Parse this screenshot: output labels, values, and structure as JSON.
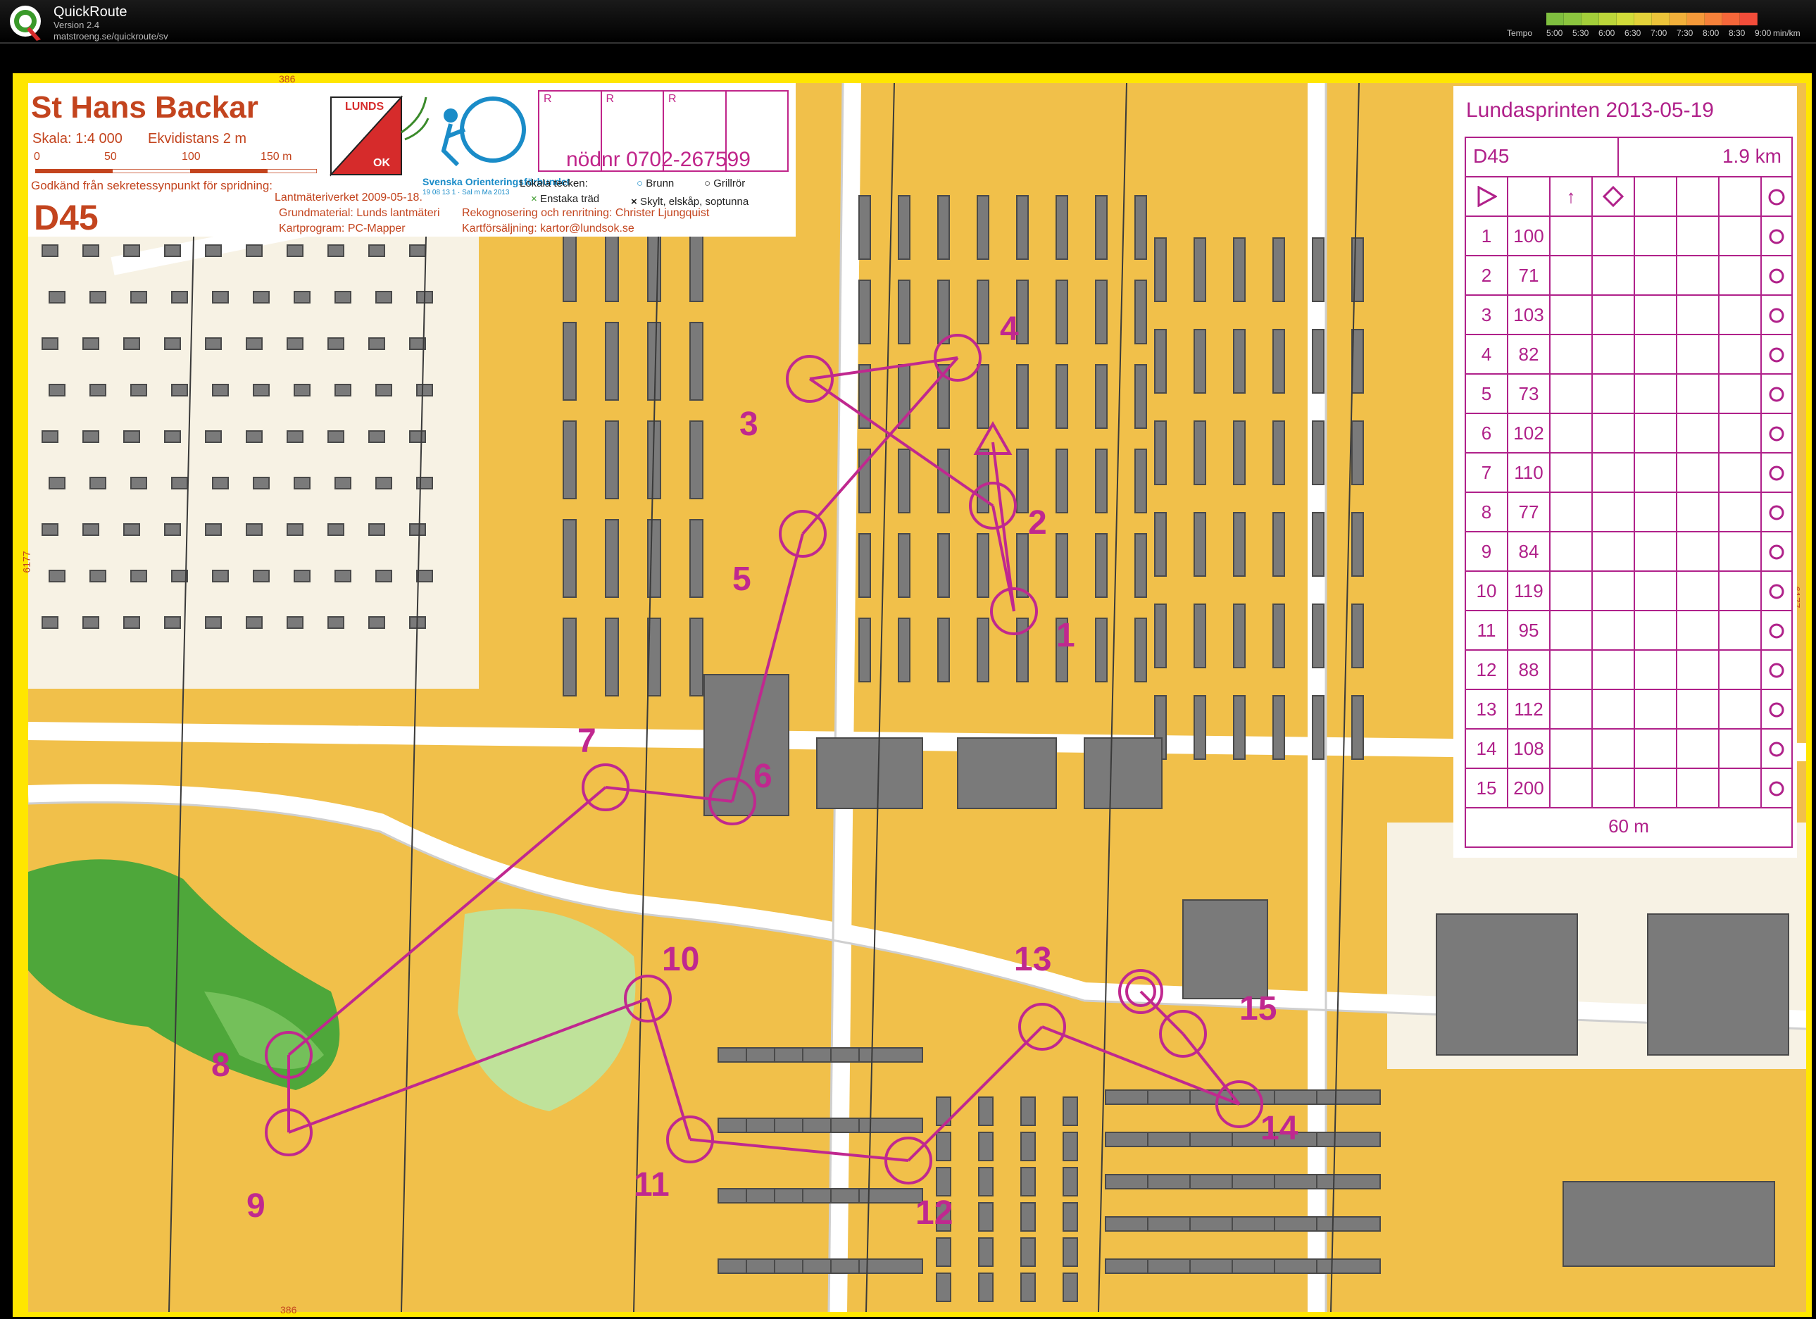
{
  "app": {
    "title": "QuickRoute",
    "version": "Version 2.4",
    "url": "matstroeng.se/quickroute/sv",
    "tempo_label": "Tempo",
    "tempo_ticks": [
      "5:00",
      "5:30",
      "6:00",
      "6:30",
      "7:00",
      "7:30",
      "8:00",
      "8:30",
      "9:00"
    ],
    "tempo_unit": "min/km",
    "tempo_colors": [
      "#7fbf3f",
      "#8cc63f",
      "#a3cf3a",
      "#bcd63a",
      "#d2dc3a",
      "#e3d23a",
      "#ecc43a",
      "#f2b03a",
      "#f59a3a",
      "#f6813a",
      "#f5673a",
      "#f34d3a"
    ]
  },
  "map_header": {
    "title": "St Hans Backar",
    "scale": "Skala: 1:4 000",
    "contour": "Ekvidistans 2 m",
    "scale_ticks": [
      "0",
      "50",
      "100",
      "150 m"
    ],
    "approval": "Godkänd från sekretessynpunkt för spridning:",
    "lantmateri": "Lantmäteriverket 2009-05-18.",
    "class": "D45",
    "base_material": "Grundmaterial: Lunds lantmäteri",
    "map_program": "Kartprogram: PC-Mapper",
    "survey": "Rekognosering och renritning: Christer Ljungquist",
    "map_sales": "Kartförsäljning: kartor@lundsok.se",
    "club_logo_text": [
      "LUNDS",
      "OK"
    ],
    "federation": "Svenska Orienteringsförbundet",
    "federation_date": "19 08 13 1 · Sal m Ma 2013",
    "r_labels": [
      "R",
      "R",
      "R"
    ],
    "emergency": "nödnr 0702-267599",
    "local_symbols": "Lokala tecken:",
    "well": "Brunn",
    "grill": "Grillrör",
    "single_tree": "Enstaka träd",
    "sign": "Skylt, elskåp, soptunna",
    "grid_top": "386",
    "grid_side": "6177",
    "grid_bottom": "386"
  },
  "description": {
    "title": "Lundasprinten 2013-05-19",
    "class": "D45",
    "length": "1.9 km",
    "rows": [
      {
        "n": "1",
        "code": "100"
      },
      {
        "n": "2",
        "code": "71"
      },
      {
        "n": "3",
        "code": "103"
      },
      {
        "n": "4",
        "code": "82"
      },
      {
        "n": "5",
        "code": "73"
      },
      {
        "n": "6",
        "code": "102"
      },
      {
        "n": "7",
        "code": "110"
      },
      {
        "n": "8",
        "code": "77"
      },
      {
        "n": "9",
        "code": "84"
      },
      {
        "n": "10",
        "code": "119"
      },
      {
        "n": "11",
        "code": "95"
      },
      {
        "n": "12",
        "code": "88"
      },
      {
        "n": "13",
        "code": "112"
      },
      {
        "n": "14",
        "code": "108"
      },
      {
        "n": "15",
        "code": "200"
      }
    ],
    "finish_distance": "60 m"
  },
  "controls": [
    {
      "label": "1"
    },
    {
      "label": "2"
    },
    {
      "label": "3"
    },
    {
      "label": "4"
    },
    {
      "label": "5"
    },
    {
      "label": "6"
    },
    {
      "label": "7"
    },
    {
      "label": "8"
    },
    {
      "label": "9"
    },
    {
      "label": "10"
    },
    {
      "label": "11"
    },
    {
      "label": "12"
    },
    {
      "label": "13"
    },
    {
      "label": "14"
    },
    {
      "label": "15"
    }
  ],
  "colors": {
    "course": "#c0288f",
    "header_text": "#c3441e",
    "open_land": "#f1c04a",
    "forest_green": "#4ea73a",
    "building": "#7a7a7a",
    "road": "#ffffff",
    "frame": "#ffe600"
  }
}
